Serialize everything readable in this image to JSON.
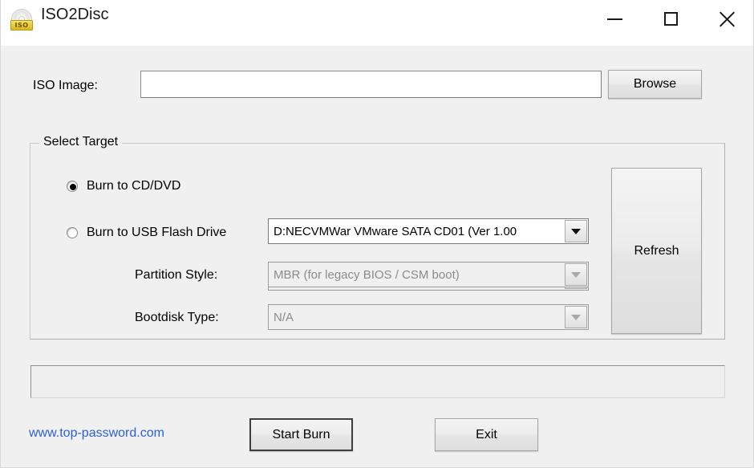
{
  "window": {
    "title": "ISO2Disc",
    "icon": "iso-disc-icon",
    "icon_banner_text": "ISO",
    "controls": {
      "minimize": "minimize-icon",
      "maximize": "maximize-icon",
      "close": "close-icon"
    }
  },
  "iso_image": {
    "label": "ISO Image:",
    "value": "",
    "placeholder": "",
    "browse_label": "Browse"
  },
  "select_target": {
    "legend": "Select Target",
    "options": [
      {
        "id": "burn-cd-dvd",
        "label": "Burn to CD/DVD",
        "checked": true
      },
      {
        "id": "burn-usb",
        "label": "Burn to USB Flash Drive",
        "checked": false
      }
    ],
    "cd_drive_combo": {
      "value": "D:NECVMWar VMware SATA CD01 (Ver 1.00",
      "enabled": true
    },
    "usb_drive_combo": {
      "value": "",
      "enabled": false
    },
    "partition_style": {
      "label": "Partition Style:",
      "value": "MBR (for legacy BIOS / CSM boot)",
      "enabled": false
    },
    "bootdisk_type": {
      "label": "Bootdisk Type:",
      "value": "N/A",
      "enabled": false
    },
    "refresh_label": "Refresh"
  },
  "status": {
    "text": ""
  },
  "footer": {
    "link": "www.top-password.com",
    "start_burn_label": "Start Burn",
    "exit_label": "Exit"
  },
  "colors": {
    "window_bg": "#f0f0f0",
    "titlebar_bg": "#ffffff",
    "link": "#2d5fd0",
    "accent_icon": "#e8c838",
    "disabled_text": "#8b8b8b"
  }
}
